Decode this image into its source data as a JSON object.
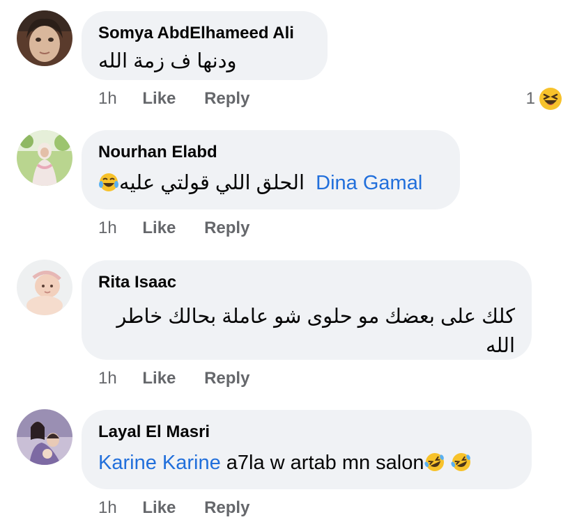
{
  "comments": [
    {
      "author": "Somya AbdElhameed Ali",
      "text": "ودنها ف زمة الله",
      "time": "1h",
      "like_label": "Like",
      "reply_label": "Reply",
      "reaction_count": "1",
      "reaction_icon": "laughing-squint-emoji-icon"
    },
    {
      "author": "Nourhan Elabd",
      "mention": "Dina Gamal",
      "text": "الحلق اللي قولتي عليه",
      "emoji_icon": "tears-of-joy-emoji-icon",
      "time": "1h",
      "like_label": "Like",
      "reply_label": "Reply"
    },
    {
      "author": "Rita Isaac",
      "text": "كلك على بعضك مو حلوى شو عاملة بحالك خاطر الله",
      "time": "1h",
      "like_label": "Like",
      "reply_label": "Reply"
    },
    {
      "author": "Layal El Masri",
      "mention": "Karine Karine",
      "text": "a7la w artab mn salon",
      "emoji_icons": [
        "rolling-on-floor-laughing-emoji-icon",
        "rolling-on-floor-laughing-emoji-icon"
      ],
      "time": "1h",
      "like_label": "Like",
      "reply_label": "Reply"
    }
  ],
  "colors": {
    "bubble": "#f0f2f5",
    "mention": "#216fdb",
    "meta": "#65676b",
    "emoji_yellow": "#f7c22b"
  }
}
